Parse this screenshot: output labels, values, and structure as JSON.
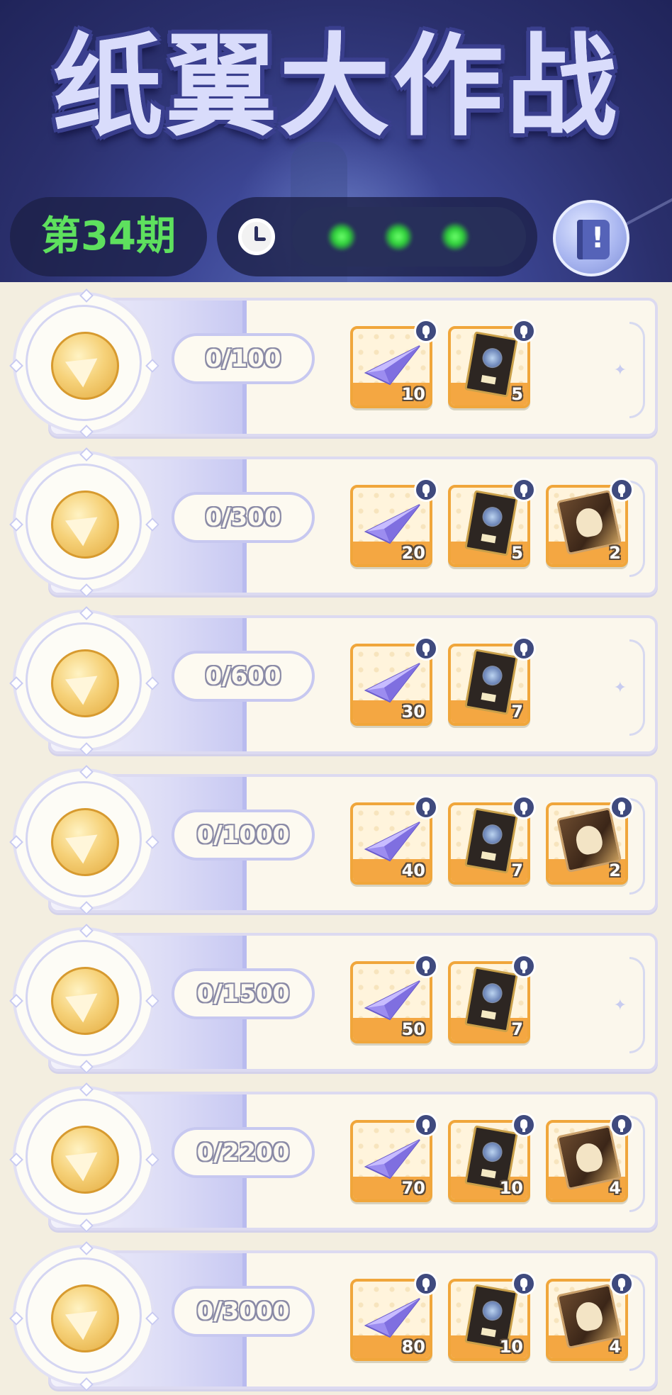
{
  "header": {
    "title": "纸翼大作战",
    "period": "第34期",
    "timer_dots": 3
  },
  "tiers": [
    {
      "progress": "0/100",
      "rewards": [
        {
          "icon": "paper-plane",
          "count": "10"
        },
        {
          "icon": "tarot-card",
          "count": "5"
        }
      ]
    },
    {
      "progress": "0/300",
      "rewards": [
        {
          "icon": "paper-plane",
          "count": "20"
        },
        {
          "icon": "tarot-card",
          "count": "5"
        },
        {
          "icon": "scroll",
          "count": "2"
        }
      ]
    },
    {
      "progress": "0/600",
      "rewards": [
        {
          "icon": "paper-plane",
          "count": "30"
        },
        {
          "icon": "tarot-card",
          "count": "7"
        }
      ]
    },
    {
      "progress": "0/1000",
      "rewards": [
        {
          "icon": "paper-plane",
          "count": "40"
        },
        {
          "icon": "tarot-card",
          "count": "7"
        },
        {
          "icon": "scroll",
          "count": "2"
        }
      ]
    },
    {
      "progress": "0/1500",
      "rewards": [
        {
          "icon": "paper-plane",
          "count": "50"
        },
        {
          "icon": "tarot-card",
          "count": "7"
        }
      ]
    },
    {
      "progress": "0/2200",
      "rewards": [
        {
          "icon": "paper-plane",
          "count": "70"
        },
        {
          "icon": "tarot-card",
          "count": "10"
        },
        {
          "icon": "scroll",
          "count": "4"
        }
      ]
    },
    {
      "progress": "0/3000",
      "rewards": [
        {
          "icon": "paper-plane",
          "count": "80"
        },
        {
          "icon": "tarot-card",
          "count": "10"
        },
        {
          "icon": "scroll",
          "count": "4"
        }
      ]
    }
  ],
  "colors": {
    "header_bg": "#2a2f6c",
    "period_text": "#5ee05e",
    "reward_border": "#f0a63b",
    "card_border": "#dcdaf1"
  }
}
